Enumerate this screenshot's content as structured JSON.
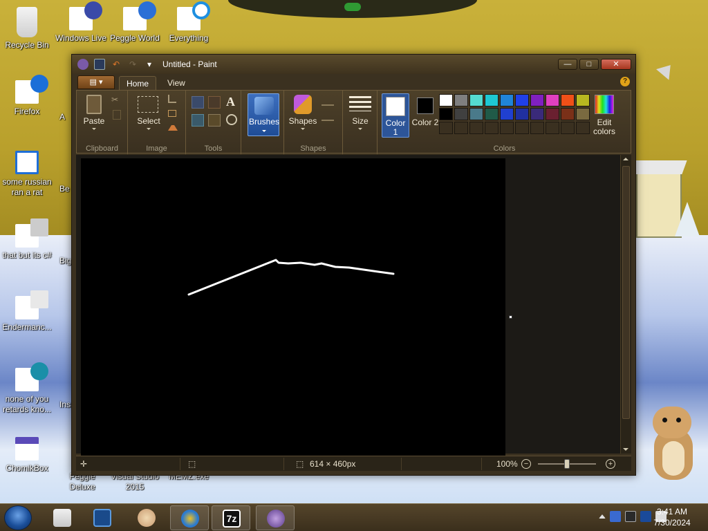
{
  "desktop": {
    "icons": [
      {
        "label": "Recycle Bin"
      },
      {
        "label": "Windows Live"
      },
      {
        "label": "Peggle World"
      },
      {
        "label": "Everything"
      },
      {
        "label": "Firefox"
      },
      {
        "label": "some russian ran a rat"
      },
      {
        "label": "that but its c#"
      },
      {
        "label": "Endermanc..."
      },
      {
        "label": "none of you retards kno..."
      },
      {
        "label": "ChomikBox"
      },
      {
        "label": "Peggle Deluxe"
      },
      {
        "label": "Visual Studio 2015"
      },
      {
        "label": "MEMZ.exe"
      }
    ],
    "partial_labels": [
      "A",
      "t",
      "Be",
      "E",
      "Big",
      "I",
      "C",
      "Insa"
    ]
  },
  "window": {
    "title": "Untitled - Paint",
    "minimize": "—",
    "maximize": "□",
    "close": "✕"
  },
  "tabs": [
    {
      "label": "Home",
      "active": true
    },
    {
      "label": "View",
      "active": false
    }
  ],
  "ribbon": {
    "groups": {
      "clipboard": "Clipboard",
      "image": "Image",
      "tools": "Tools",
      "shapes": "Shapes",
      "colors": "Colors"
    },
    "buttons": {
      "paste": "Paste",
      "select": "Select",
      "brushes": "Brushes",
      "shapes": "Shapes",
      "size": "Size",
      "color1": "Color 1",
      "color2": "Color 2",
      "edit_colors": "Edit colors"
    },
    "tool_text_icon": "A",
    "color1_value": "#ffffff",
    "color2_value": "#000000",
    "palette_row1": [
      "#ffffff",
      "#7f7f7f",
      "#55dcd0",
      "#1ec8d2",
      "#2084d8",
      "#2040e8",
      "#8020c0",
      "#e040c0",
      "#f05018",
      "#b8b820",
      "#58b040",
      "#ffffff"
    ],
    "palette_row2": [
      "#000000",
      "#404040",
      "#4a7a8a",
      "#205a48",
      "#2040d0",
      "#2030a0",
      "#3a2a7a",
      "#6a2030",
      "#7a3018",
      "#7a6a40",
      "#3a5a30",
      "#000000"
    ]
  },
  "canvas": {
    "background": "#000000",
    "stroke_color": "#ffffff"
  },
  "statusbar": {
    "dimensions": "614 × 460px",
    "zoom": "100%",
    "zoom_out": "−",
    "zoom_in": "+"
  },
  "taskbar": {
    "time": "3:41 AM",
    "date": "7/30/2024",
    "sevenzip_label": "7z"
  }
}
